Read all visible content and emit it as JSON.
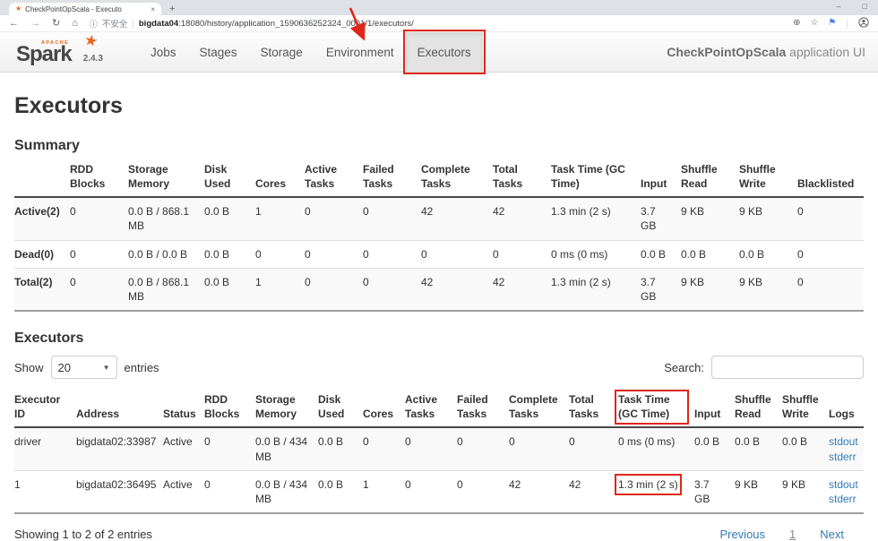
{
  "browser": {
    "tab_title": "CheckPointOpScala - Executo",
    "security_text": "不安全",
    "url_separator": "|",
    "url_host": "bigdata04",
    "url_path": ":18080/history/application_1590636252324_0001/1/executors/"
  },
  "icons": {
    "favicon": "★",
    "close": "×",
    "plus": "+",
    "minimize": "–",
    "maximize": "□",
    "back": "←",
    "forward": "→",
    "refresh": "↻",
    "home": "⌂",
    "info": "ⓘ",
    "zoom": "⊕",
    "star": "☆",
    "extension": "⚑",
    "logo_star": "★",
    "caret": "▼"
  },
  "header": {
    "logo_apache": "APACHE",
    "logo_text": "Spark",
    "version": "2.4.3",
    "nav": [
      "Jobs",
      "Stages",
      "Storage",
      "Environment",
      "Executors"
    ],
    "app_name": "CheckPointOpScala",
    "app_suffix": "application UI"
  },
  "page": {
    "title": "Executors",
    "summary_heading": "Summary",
    "executors_heading": "Executors"
  },
  "summary_table": {
    "headers": [
      "",
      "RDD Blocks",
      "Storage Memory",
      "Disk Used",
      "Cores",
      "Active Tasks",
      "Failed Tasks",
      "Complete Tasks",
      "Total Tasks",
      "Task Time (GC Time)",
      "Input",
      "Shuffle Read",
      "Shuffle Write",
      "Blacklisted"
    ],
    "rows": [
      {
        "label": "Active(2)",
        "cells": [
          "0",
          "0.0 B / 868.1 MB",
          "0.0 B",
          "1",
          "0",
          "0",
          "42",
          "42",
          "1.3 min (2 s)",
          "3.7 GB",
          "9 KB",
          "9 KB",
          "0"
        ]
      },
      {
        "label": "Dead(0)",
        "cells": [
          "0",
          "0.0 B / 0.0 B",
          "0.0 B",
          "0",
          "0",
          "0",
          "0",
          "0",
          "0 ms (0 ms)",
          "0.0 B",
          "0.0 B",
          "0.0 B",
          "0"
        ]
      },
      {
        "label": "Total(2)",
        "cells": [
          "0",
          "0.0 B / 868.1 MB",
          "0.0 B",
          "1",
          "0",
          "0",
          "42",
          "42",
          "1.3 min (2 s)",
          "3.7 GB",
          "9 KB",
          "9 KB",
          "0"
        ]
      }
    ]
  },
  "controls": {
    "show_label": "Show",
    "entries_value": "20",
    "entries_suffix": "entries",
    "search_label": "Search:"
  },
  "executors_table": {
    "headers": [
      "Executor ID",
      "Address",
      "Status",
      "RDD Blocks",
      "Storage Memory",
      "Disk Used",
      "Cores",
      "Active Tasks",
      "Failed Tasks",
      "Complete Tasks",
      "Total Tasks",
      "Task Time (GC Time)",
      "Input",
      "Shuffle Read",
      "Shuffle Write",
      "Logs"
    ],
    "rows": [
      {
        "cells": [
          "driver",
          "bigdata02:33987",
          "Active",
          "0",
          "0.0 B / 434 MB",
          "0.0 B",
          "0",
          "0",
          "0",
          "0",
          "0",
          "0 ms (0 ms)",
          "0.0 B",
          "0.0 B",
          "0.0 B"
        ],
        "logs": [
          "stdout",
          "stderr"
        ]
      },
      {
        "cells": [
          "1",
          "bigdata02:36495",
          "Active",
          "0",
          "0.0 B / 434 MB",
          "0.0 B",
          "1",
          "0",
          "0",
          "42",
          "42",
          "1.3 min (2 s)",
          "3.7 GB",
          "9 KB",
          "9 KB"
        ],
        "logs": [
          "stdout",
          "stderr"
        ]
      }
    ]
  },
  "footer": {
    "showing_text": "Showing 1 to 2 of 2 entries",
    "previous_label": "Previous",
    "current_page": "1",
    "next_label": "Next"
  },
  "colors": {
    "annotation-red": "#e0261a",
    "link-blue": "#337ab7",
    "spark-orange": "#e8641f"
  }
}
